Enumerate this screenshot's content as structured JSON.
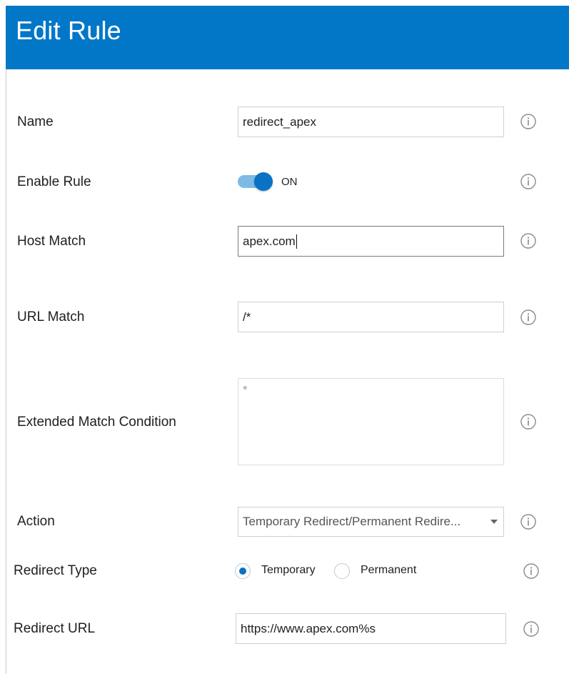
{
  "header": {
    "title": "Edit Rule"
  },
  "form": {
    "name": {
      "label": "Name",
      "value": "redirect_apex"
    },
    "enable_rule": {
      "label": "Enable Rule",
      "state_text": "ON",
      "enabled": true
    },
    "host_match": {
      "label": "Host Match",
      "value": "apex.com"
    },
    "url_match": {
      "label": "URL Match",
      "value": "/*"
    },
    "extended_match": {
      "label": "Extended Match Condition",
      "placeholder": "*"
    },
    "action": {
      "label": "Action",
      "selected": "Temporary Redirect/Permanent Redire..."
    },
    "redirect_type": {
      "label": "Redirect Type",
      "options": [
        "Temporary",
        "Permanent"
      ],
      "selected": "Temporary"
    },
    "redirect_url": {
      "label": "Redirect URL",
      "value": "https://www.apex.com%s"
    }
  },
  "icons": {
    "info": "info-circle-icon"
  },
  "colors": {
    "header": "#0277c8",
    "accent": "#0a72c5",
    "toggle_track": "#7dbbe6"
  }
}
